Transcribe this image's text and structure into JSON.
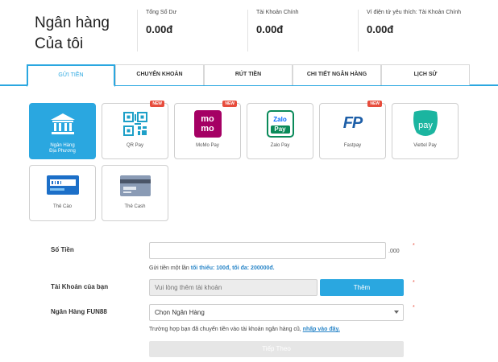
{
  "header": {
    "title_line1": "Ngân hàng",
    "title_line2": "Của tôi",
    "stats": [
      {
        "label": "Tổng Số Dư",
        "value": "0.00đ"
      },
      {
        "label": "Tài Khoản Chính",
        "value": "0.00đ"
      },
      {
        "label": "Ví điện tử yêu thích: Tài Khoản Chính",
        "value": "0.00đ"
      }
    ]
  },
  "tabs": [
    {
      "label": "Gửi Tiền"
    },
    {
      "label": "Chuyển Khoản"
    },
    {
      "label": "Rút Tiền"
    },
    {
      "label": "Chi Tiết Ngân Hàng"
    },
    {
      "label": "Lịch Sử"
    }
  ],
  "methods": [
    {
      "label_line1": "Ngân Hàng",
      "label_line2": "Địa Phương",
      "icon": "bank-icon"
    },
    {
      "label_line1": "QR Pay",
      "icon": "qr-code-icon",
      "badge": "NEW"
    },
    {
      "label_line1": "MoMo Pay",
      "icon": "momo-logo-icon",
      "badge": "NEW"
    },
    {
      "label_line1": "Zalo Pay",
      "icon": "zalopay-logo-icon"
    },
    {
      "label_line1": "Fastpay",
      "icon": "fastpay-logo-icon",
      "badge": "NEW"
    },
    {
      "label_line1": "Viettel Pay",
      "icon": "viettelpay-logo-icon"
    },
    {
      "label_line1": "Thẻ Cào",
      "icon": "scratch-card-icon"
    },
    {
      "label_line1": "Thẻ Cash",
      "icon": "cash-card-icon"
    }
  ],
  "logo_text": {
    "momo": "mo",
    "momo2": "mo",
    "zalo": "Zalo",
    "zalo2": "Pay",
    "fp": "FP",
    "viettel": "pay"
  },
  "form": {
    "amount_label": "Số Tiền",
    "amount_value": "",
    "amount_suffix": ".000",
    "required_mark": "*",
    "hint_prefix": "Gửi tiền một lần ",
    "hint_min": "tối thiểu:  100đ, tối đa: 200000đ.",
    "account_label": "Tài Khoản của bạn",
    "account_placeholder": "Vui lòng thêm tài khoản",
    "add_button": "Thêm",
    "bank_label": "Ngân Hàng FUN88",
    "bank_selected": "Chọn Ngân Hàng",
    "note_prefix": "Trường hợp bạn đã chuyển tiền vào tài khoản ngân hàng cũ, ",
    "note_link": "nhấp vào đây.",
    "submit_button": "Tiếp Theo"
  },
  "colors": {
    "accent": "#2aa7e0",
    "momo": "#a50064",
    "fastpay_red": "#e2231a",
    "fastpay_blue": "#1e5fa8",
    "viettel": "#1bb5a0"
  }
}
